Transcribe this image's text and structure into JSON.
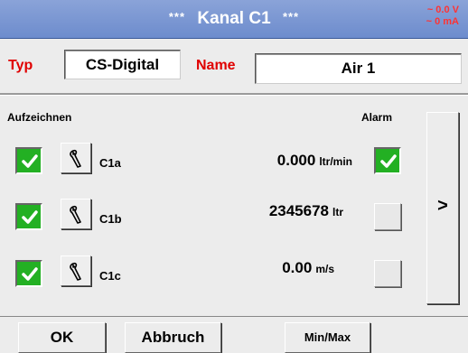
{
  "header": {
    "stars_left": "***",
    "title": "Kanal C1",
    "stars_right": "***",
    "voltage": "~ 0.0 V",
    "current": "~ 0 mA"
  },
  "config": {
    "type_label": "Typ",
    "type_value": "CS-Digital",
    "name_label": "Name",
    "name_value": "Air 1"
  },
  "columns": {
    "record_label": "Aufzeichnen",
    "alarm_label": "Alarm"
  },
  "channels": [
    {
      "id": "C1a",
      "value": "0.000",
      "unit": "ltr/min",
      "record": true,
      "alarm": true
    },
    {
      "id": "C1b",
      "value": "2345678",
      "unit": "ltr",
      "record": true,
      "alarm": false
    },
    {
      "id": "C1c",
      "value": "0.00",
      "unit": "m/s",
      "record": true,
      "alarm": false
    }
  ],
  "next_button": ">",
  "footer": {
    "ok_label": "OK",
    "cancel_label": "Abbruch",
    "minmax_label": "Min/Max"
  },
  "icons": {
    "settings": "wrench-icon",
    "checked": "checkmark-icon"
  },
  "colors": {
    "title_bar": "#7b97d3",
    "accent_red": "#e00000",
    "checked_green": "#23b023",
    "panel_bg": "#ececec"
  }
}
